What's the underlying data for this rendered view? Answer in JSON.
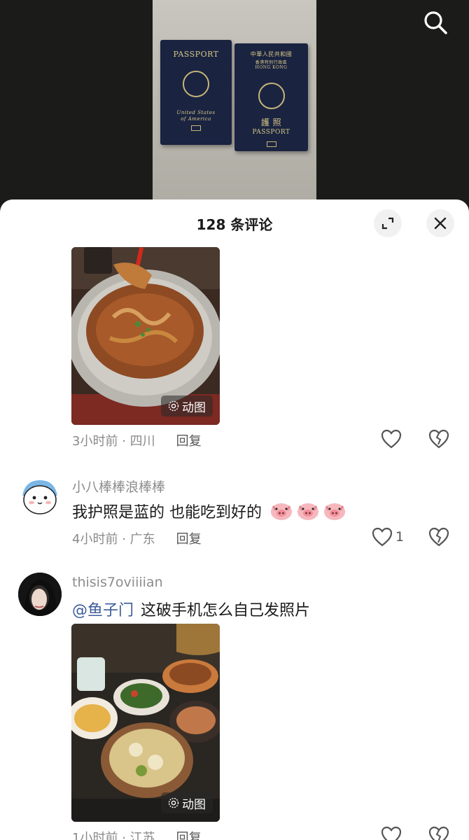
{
  "header": {
    "title": "128 条评论",
    "expand_icon": "expand-icon",
    "close_icon": "close-icon"
  },
  "media": {
    "search_icon": "search-icon",
    "us_passport_title": "PASSPORT",
    "us_passport_sub1": "United States",
    "us_passport_sub2": "of America",
    "hk_passport_top": "中華人民共和國",
    "hk_passport_sub1": "香港特別行政區",
    "hk_passport_sub2": "HONG KONG",
    "hk_passport_cn": "護 照",
    "hk_passport_title": "PASSPORT"
  },
  "comments": [
    {
      "image_badge": "动图",
      "time_location": "3小时前 · 四川",
      "reply": "回复",
      "like_count": ""
    },
    {
      "username": "小八棒棒浪棒棒",
      "text": "我护照是蓝的 也能吃到好的",
      "emojis": [
        "pig-face",
        "pig-face",
        "pig-face"
      ],
      "time_location": "4小时前 · 广东",
      "reply": "回复",
      "like_count": "1"
    },
    {
      "username": "thisis7oviiiian",
      "mention": "@鱼子门",
      "text": "这破手机怎么自己发照片",
      "image_badge": "动图",
      "time_location": "1小时前 · 江苏",
      "reply": "回复",
      "like_count": ""
    }
  ],
  "colors": {
    "mention": "#3b5b99",
    "meta": "#8a8a8a",
    "text": "#1a1a1a"
  }
}
